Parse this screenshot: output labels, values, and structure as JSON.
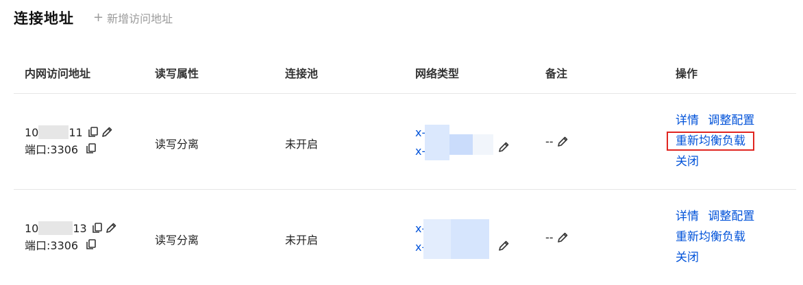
{
  "header": {
    "title": "连接地址",
    "add_label": "新增访问地址"
  },
  "table": {
    "columns": [
      "内网访问地址",
      "读写属性",
      "连接池",
      "网络类型",
      "备注",
      "操作"
    ],
    "rows": [
      {
        "address_prefix": "10",
        "address_suffix": "11",
        "port": "端口:3306",
        "rw": "读写分离",
        "pool": "未开启",
        "network_line1": "x-",
        "network_line2": "x-",
        "remark": "--",
        "ops": {
          "detail": "详情",
          "config": "调整配置",
          "rebalance": "重新均衡负载",
          "close": "关闭"
        }
      },
      {
        "address_prefix": "10",
        "address_suffix": "13",
        "port": "端口:3306",
        "rw": "读写分离",
        "pool": "未开启",
        "network_line1": "x-",
        "network_line2": "x-",
        "remark": "--",
        "ops": {
          "detail": "详情",
          "config": "调整配置",
          "rebalance": "重新均衡负载",
          "close": "关闭"
        }
      }
    ]
  },
  "colors": {
    "link": "#0052d9",
    "highlight": "#e0241f",
    "muted": "#9a9a9a"
  },
  "icons": [
    "plus-icon",
    "copy-icon",
    "edit-icon"
  ]
}
